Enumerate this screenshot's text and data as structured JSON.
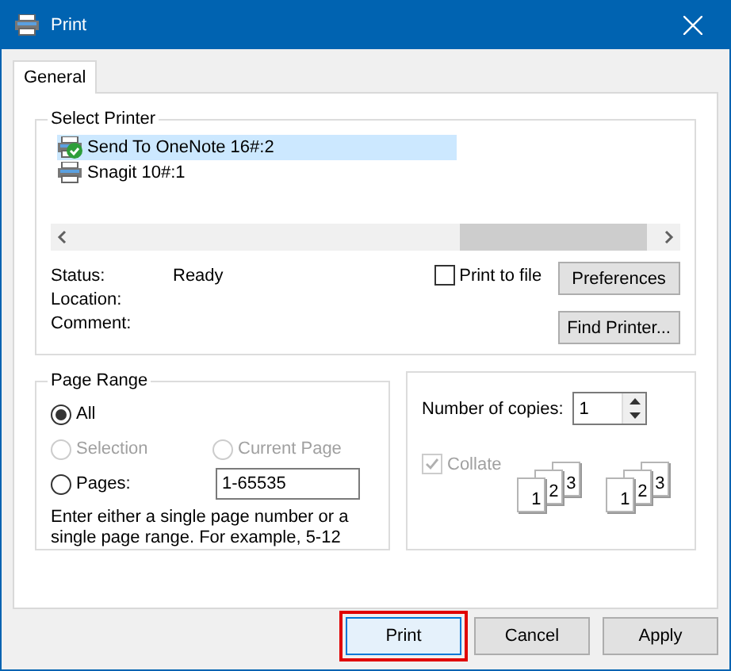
{
  "window": {
    "title": "Print"
  },
  "tabs": [
    {
      "label": "General",
      "selected": true
    }
  ],
  "select_printer": {
    "title": "Select Printer",
    "printers": [
      {
        "name": "Send To OneNote 16#:2",
        "kind": "onenote",
        "selected": true
      },
      {
        "name": "Snagit 10#:1",
        "kind": "printer",
        "selected": false
      }
    ],
    "info": [
      {
        "label": "Status:",
        "value": "Ready"
      },
      {
        "label": "Location:"
      },
      {
        "label": "Comment:"
      }
    ],
    "print_to_file": {
      "label": "Print to file",
      "checked": false
    },
    "buttons": [
      "Preferences",
      "Find Printer..."
    ]
  },
  "page_range": {
    "title": "Page Range",
    "options": [
      {
        "label": "All",
        "selected": true,
        "disabled": false
      },
      {
        "label": "Selection",
        "selected": false,
        "disabled": true
      },
      {
        "label": "Current Page",
        "selected": false,
        "disabled": true
      },
      {
        "label": "Pages:",
        "selected": false,
        "disabled": false
      }
    ],
    "pages_value": "1-65535",
    "hint": "Enter either a single page number or a single page range.  For example, 5-12"
  },
  "copies": {
    "label": "Number of copies:",
    "value": "1",
    "collate": {
      "label": "Collate",
      "checked": true,
      "disabled": true
    },
    "collate_icons": [
      [
        "1",
        "2",
        "3"
      ],
      [
        "1",
        "2",
        "3"
      ]
    ]
  },
  "buttons": [
    {
      "label": "Print",
      "highlighted": true
    },
    {
      "label": "Cancel",
      "highlighted": false
    },
    {
      "label": "Apply",
      "highlighted": false
    }
  ]
}
